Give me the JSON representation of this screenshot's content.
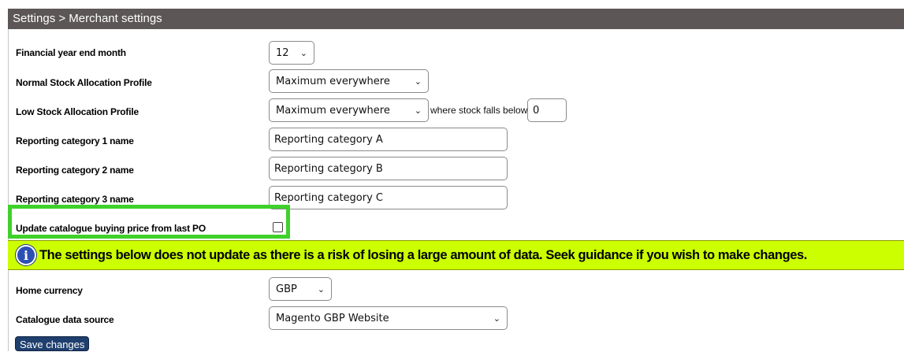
{
  "header": {
    "breadcrumb": "Settings > Merchant settings"
  },
  "form": {
    "financial_year_end_month": {
      "label": "Financial year end month",
      "value": "12"
    },
    "normal_stock_profile": {
      "label": "Normal Stock Allocation Profile",
      "value": "Maximum everywhere"
    },
    "low_stock_profile": {
      "label": "Low Stock Allocation Profile",
      "value": "Maximum everywhere",
      "threshold_label": "where stock falls below",
      "threshold_value": "0"
    },
    "reporting_category_1": {
      "label": "Reporting category 1 name",
      "value": "Reporting category A"
    },
    "reporting_category_2": {
      "label": "Reporting category 2 name",
      "value": "Reporting category B"
    },
    "reporting_category_3": {
      "label": "Reporting category 3 name",
      "value": "Reporting category C"
    },
    "update_buying_price": {
      "label": "Update catalogue buying price from last PO",
      "checked": false
    },
    "notice": {
      "icon": "info-icon",
      "text": "The settings below does not update as there is a risk of losing a large amount of data. Seek guidance if you wish to make changes."
    },
    "home_currency": {
      "label": "Home currency",
      "value": "GBP"
    },
    "catalogue_data_source": {
      "label": "Catalogue data source",
      "value": "Magento GBP Website"
    },
    "save_label": "Save changes"
  },
  "colors": {
    "header_bg": "#5c5656",
    "notice_bg": "#ccff00",
    "highlight_border": "#3fd12a",
    "save_button_bg": "#1f3f6e"
  }
}
